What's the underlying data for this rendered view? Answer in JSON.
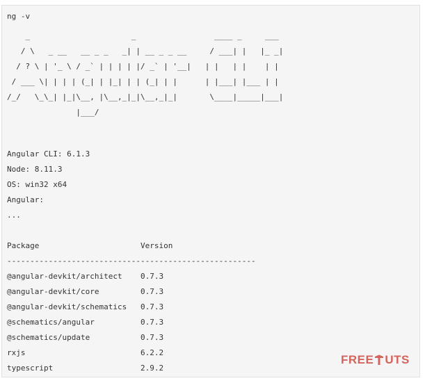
{
  "terminal": {
    "command": "ng -v",
    "banner_ascii": "    _                      _                 ____ _     ___\n   / \\   _ __   __ _ _   _| | __ _ _ __     / ___| |   |_ _|\n  / ? \\ | '_ \\ / _` | | | | |/ _` | '__|   | |   | |    | |\n / ___ \\| | | | (_| | |_| | | (_| | |      | |___| |___ | |\n/_/   \\_\\_| |_|\\__, |\\__,_|_|\\__,_|_|       \\____|_____|___|\n               |___/",
    "info": [
      "Angular CLI: 6.1.3",
      "Node: 8.11.3",
      "OS: win32 x64",
      "Angular:",
      "..."
    ],
    "table_header": "Package                      Version",
    "table_rule": "------------------------------------------------------",
    "packages": [
      "@angular-devkit/architect    0.7.3",
      "@angular-devkit/core         0.7.3",
      "@angular-devkit/schematics   0.7.3",
      "@schematics/angular          0.7.3",
      "@schematics/update           0.7.3",
      "rxjs                         6.2.2",
      "typescript                   2.9.2"
    ]
  },
  "watermark": {
    "text_left": "FREE",
    "text_right": "UTS",
    "icon": "tree-t-icon",
    "color": "#c9342a"
  }
}
